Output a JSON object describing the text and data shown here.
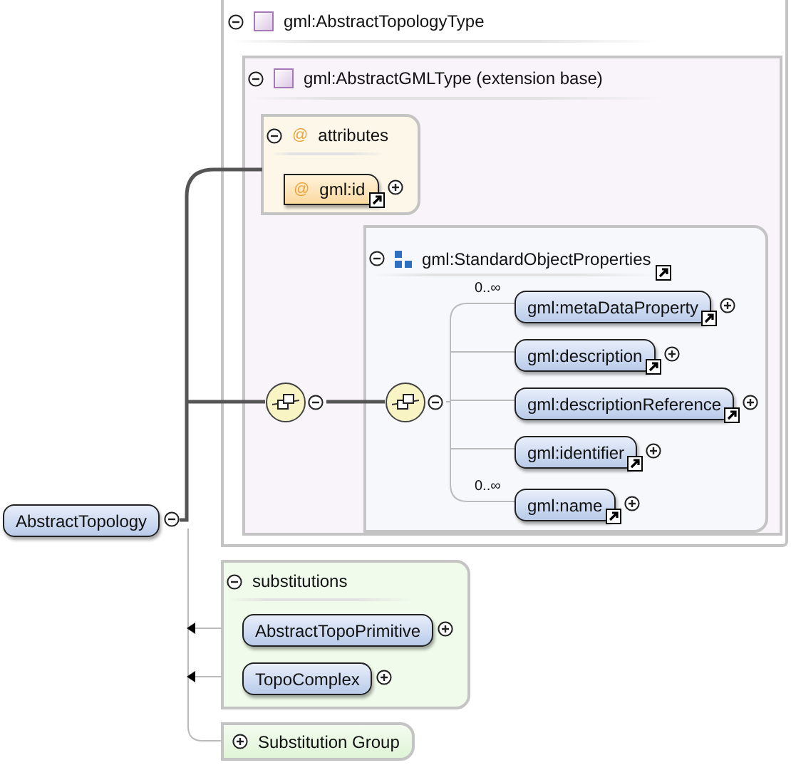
{
  "type_box": {
    "title": "gml:AbstractTopologyType",
    "expanded": true
  },
  "base_box": {
    "title": "gml:AbstractGMLType (extension base)",
    "expanded": true
  },
  "attributes": {
    "icon": "@",
    "title": "attributes",
    "expanded": true,
    "items": [
      {
        "icon": "@",
        "name": "gml:id",
        "expanded": false
      }
    ]
  },
  "compositors": [
    {
      "expanded": true
    },
    {
      "expanded": true
    }
  ],
  "group": {
    "title": "gml:StandardObjectProperties",
    "expanded": true,
    "elements": [
      {
        "name": "gml:metaDataProperty",
        "occurs": "0..∞",
        "expanded": false
      },
      {
        "name": "gml:description",
        "expanded": false
      },
      {
        "name": "gml:descriptionReference",
        "expanded": false
      },
      {
        "name": "gml:identifier",
        "expanded": false
      },
      {
        "name": "gml:name",
        "occurs": "0..∞",
        "expanded": false
      }
    ]
  },
  "root": {
    "name": "AbstractTopology",
    "expanded": true
  },
  "substitutions": {
    "title": "substitutions",
    "expanded": true,
    "items": [
      {
        "name": "AbstractTopoPrimitive",
        "expanded": false
      },
      {
        "name": "TopoComplex",
        "expanded": false
      }
    ]
  },
  "substitution_group": {
    "label": "Substitution Group",
    "expanded": false
  }
}
